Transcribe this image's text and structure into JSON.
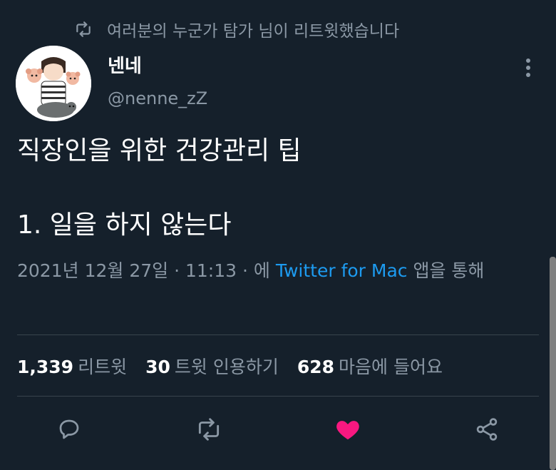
{
  "retweet_context": {
    "text": "여러분의 누군가 탐가 님이 리트윗했습니다",
    "icon": "retweet-icon"
  },
  "author": {
    "display_name": "넨네",
    "handle": "@nenne_zZ",
    "avatar": "avatar-illustration"
  },
  "tweet": {
    "text": "직장인을 위한 건강관리 팁\n\n1. 일을 하지 않는다"
  },
  "meta": {
    "timestamp": "2021년 12월 27일 · 11:13 · 에",
    "source": "Twitter for Mac",
    "suffix": "앱을 통해"
  },
  "stats": [
    {
      "count": "1,339",
      "label": "리트윗"
    },
    {
      "count": "30",
      "label": "트윗 인용하기"
    },
    {
      "count": "628",
      "label": "마음에 들어요"
    }
  ],
  "actions": [
    "reply-icon",
    "retweet-icon",
    "like-icon",
    "share-icon"
  ],
  "colors": {
    "background": "#15202b",
    "secondary": "#8b98a5",
    "link": "#1d9bf0",
    "like": "#f91880",
    "divider": "#38444d"
  }
}
